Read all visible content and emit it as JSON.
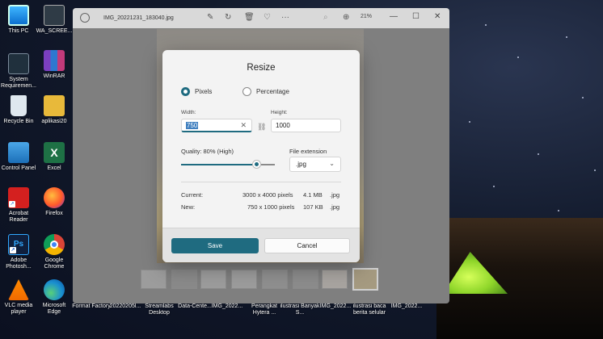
{
  "desktop_icons": [
    {
      "label": "This PC",
      "icon": "monitor-icon"
    },
    {
      "label": "WA_SCREE...",
      "icon": "image-file-icon"
    },
    {
      "label": "System Requiremen...",
      "icon": "system-icon"
    },
    {
      "label": "WinRAR",
      "icon": "archive-icon"
    },
    {
      "label": "Recycle Bin",
      "icon": "recycle-bin-icon"
    },
    {
      "label": "aplikasi20",
      "icon": "folder-icon"
    },
    {
      "label": "Control Panel",
      "icon": "control-panel-icon"
    },
    {
      "label": "Excel",
      "icon": "excel-icon"
    },
    {
      "label": "Acrobat Reader",
      "icon": "acrobat-icon"
    },
    {
      "label": "Firefox",
      "icon": "firefox-icon"
    },
    {
      "label": "Adobe Photosh...",
      "icon": "photoshop-icon"
    },
    {
      "label": "Google Chrome",
      "icon": "chrome-icon"
    },
    {
      "label": "VLC media player",
      "icon": "vlc-icon"
    },
    {
      "label": "Microsoft Edge",
      "icon": "edge-icon"
    }
  ],
  "desktop_files": [
    "Format Factory",
    "20220205l...",
    "Streamlabs Desktop",
    "Data-Cente...",
    "IMG_2022...",
    "Perangkat Hytera ...",
    "ilustrasi Banyak S...",
    "IMG_2022...",
    "ilustrasi baca berita selular",
    "IMG_2022..."
  ],
  "window": {
    "title": "IMG_20221231_183040.jpg",
    "zoom": "21%",
    "controls": {
      "minimize": "—",
      "maximize": "☐",
      "close": "✕"
    }
  },
  "dialog": {
    "title": "Resize",
    "mode_pixels": "Pixels",
    "mode_percentage": "Percentage",
    "selected_mode": "Pixels",
    "width_label": "Width:",
    "width_value": "750",
    "height_label": "Height:",
    "height_value": "1000",
    "quality_label": "Quality: 80% (High)",
    "quality_value": 80,
    "extension_label": "File extension",
    "extension_value": ".jpg",
    "current_label": "Current:",
    "current_dims": "3000 x 4000 pixels",
    "current_size": "4.1 MB",
    "current_ext": ".jpg",
    "new_label": "New:",
    "new_dims": "750 x 1000 pixels",
    "new_size": "107 KB",
    "new_ext": ".jpg",
    "save_label": "Save",
    "cancel_label": "Cancel"
  },
  "colors": {
    "accent": "#1f6b80"
  }
}
